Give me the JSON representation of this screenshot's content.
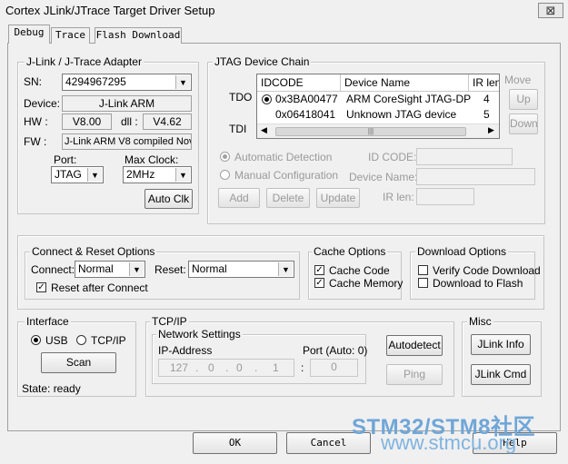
{
  "window": {
    "title": "Cortex JLink/JTrace Target Driver Setup",
    "close_glyph": "⊠"
  },
  "tabs": {
    "debug": "Debug",
    "trace": "Trace",
    "flash": "Flash Download"
  },
  "adapter": {
    "group": "J-Link / J-Trace Adapter",
    "sn_label": "SN:",
    "sn_value": "4294967295",
    "device_label": "Device:",
    "device_value": "J-Link ARM",
    "hw_label": "HW :",
    "hw_value": "V8.00",
    "dll_label": "dll :",
    "dll_value": "V4.62",
    "fw_label": "FW :",
    "fw_value": "J-Link ARM V8 compiled Nov",
    "port_label": "Port:",
    "port_value": "JTAG",
    "clock_label": "Max Clock:",
    "clock_value": "2MHz",
    "autoclk": "Auto Clk"
  },
  "jtag": {
    "group": "JTAG Device Chain",
    "tdo": "TDO",
    "tdi": "TDI",
    "columns": [
      "IDCODE",
      "Device Name",
      "IR len"
    ],
    "rows": [
      {
        "idcode": "0x3BA00477",
        "name": "ARM CoreSight JTAG-DP",
        "irlen": "4"
      },
      {
        "idcode": "0x06418041",
        "name": "Unknown JTAG device",
        "irlen": "5"
      }
    ],
    "move": "Move",
    "up": "Up",
    "down": "Down",
    "auto_detection": "Automatic Detection",
    "manual_config": "Manual Configuration",
    "id_code_label": "ID CODE:",
    "device_name_label": "Device Name:",
    "ir_len_label": "IR len:",
    "add": "Add",
    "delete": "Delete",
    "update": "Update"
  },
  "connect": {
    "group": "Connect & Reset Options",
    "connect_label": "Connect:",
    "connect_value": "Normal",
    "reset_label": "Reset:",
    "reset_value": "Normal",
    "reset_after": "Reset after Connect"
  },
  "cache": {
    "group": "Cache Options",
    "code": "Cache Code",
    "memory": "Cache Memory"
  },
  "download": {
    "group": "Download Options",
    "verify": "Verify Code Download",
    "to_flash": "Download to Flash"
  },
  "interface": {
    "group": "Interface",
    "usb": "USB",
    "tcpip": "TCP/IP",
    "scan": "Scan",
    "state": "State: ready"
  },
  "tcpip": {
    "group": "TCP/IP",
    "network": "Network Settings",
    "ip_label": "IP-Address",
    "ip": [
      "127",
      "0",
      "0",
      "1"
    ],
    "port_label": "Port (Auto: 0)",
    "port_value": "0",
    "autodetect": "Autodetect",
    "ping": "Ping"
  },
  "misc": {
    "group": "Misc",
    "jlink_info": "JLink Info",
    "jlink_cmd": "JLink Cmd"
  },
  "footer": {
    "ok": "OK",
    "cancel": "Cancel",
    "help": "Help"
  },
  "watermark": {
    "line1": "STM32/STM8社区",
    "line2": "www.stmcu.org"
  },
  "colors": {
    "accent": "#0078d7",
    "watermark": "#6fa6d8"
  }
}
